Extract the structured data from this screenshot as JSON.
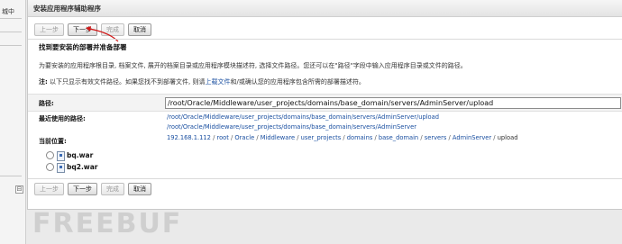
{
  "left_panel": {
    "fragment": "城中",
    "collapse_glyph": "⊟"
  },
  "window": {
    "title": "安装应用程序辅助程序"
  },
  "toolbar": {
    "back": "上一步",
    "next": "下一步",
    "finish": "完成",
    "cancel": "取消"
  },
  "section": {
    "title": "找到要安装的部署并准备部署",
    "description": "为要安装的应用程序根目录, 档案文件, 展开的档案目录或应用程序模块描述符, 选择文件路径。您还可以在\"路径\"字段中输入应用程序目录或文件的路径。",
    "note_label": "注:",
    "note_text_before": "以下只显示有效文件路径。如果您找不到部署文件, 则请",
    "note_link": "上载文件",
    "note_text_after": "和/或确认您的应用程序包含所需的部署描述符。"
  },
  "path": {
    "label": "路径:",
    "value": "/root/Oracle/Middleware/user_projects/domains/base_domain/servers/AdminServer/upload"
  },
  "recent": {
    "label": "最近使用的路径:",
    "paths": [
      "/root/Oracle/Middleware/user_projects/domains/base_domain/servers/AdminServer/upload",
      "/root/Oracle/Middleware/user_projects/domains/base_domain/servers/AdminServer"
    ]
  },
  "current": {
    "label": "当前位置:",
    "crumbs": [
      "192.168.1.112",
      "root",
      "Oracle",
      "Middleware",
      "user_projects",
      "domains",
      "base_domain",
      "servers",
      "AdminServer",
      "upload"
    ]
  },
  "files": [
    {
      "name": "bq.war"
    },
    {
      "name": "bq2.war"
    }
  ],
  "colors": {
    "link": "#1a4fa0",
    "annotation_arrow": "#d01818"
  },
  "watermark": "FREEBUF"
}
